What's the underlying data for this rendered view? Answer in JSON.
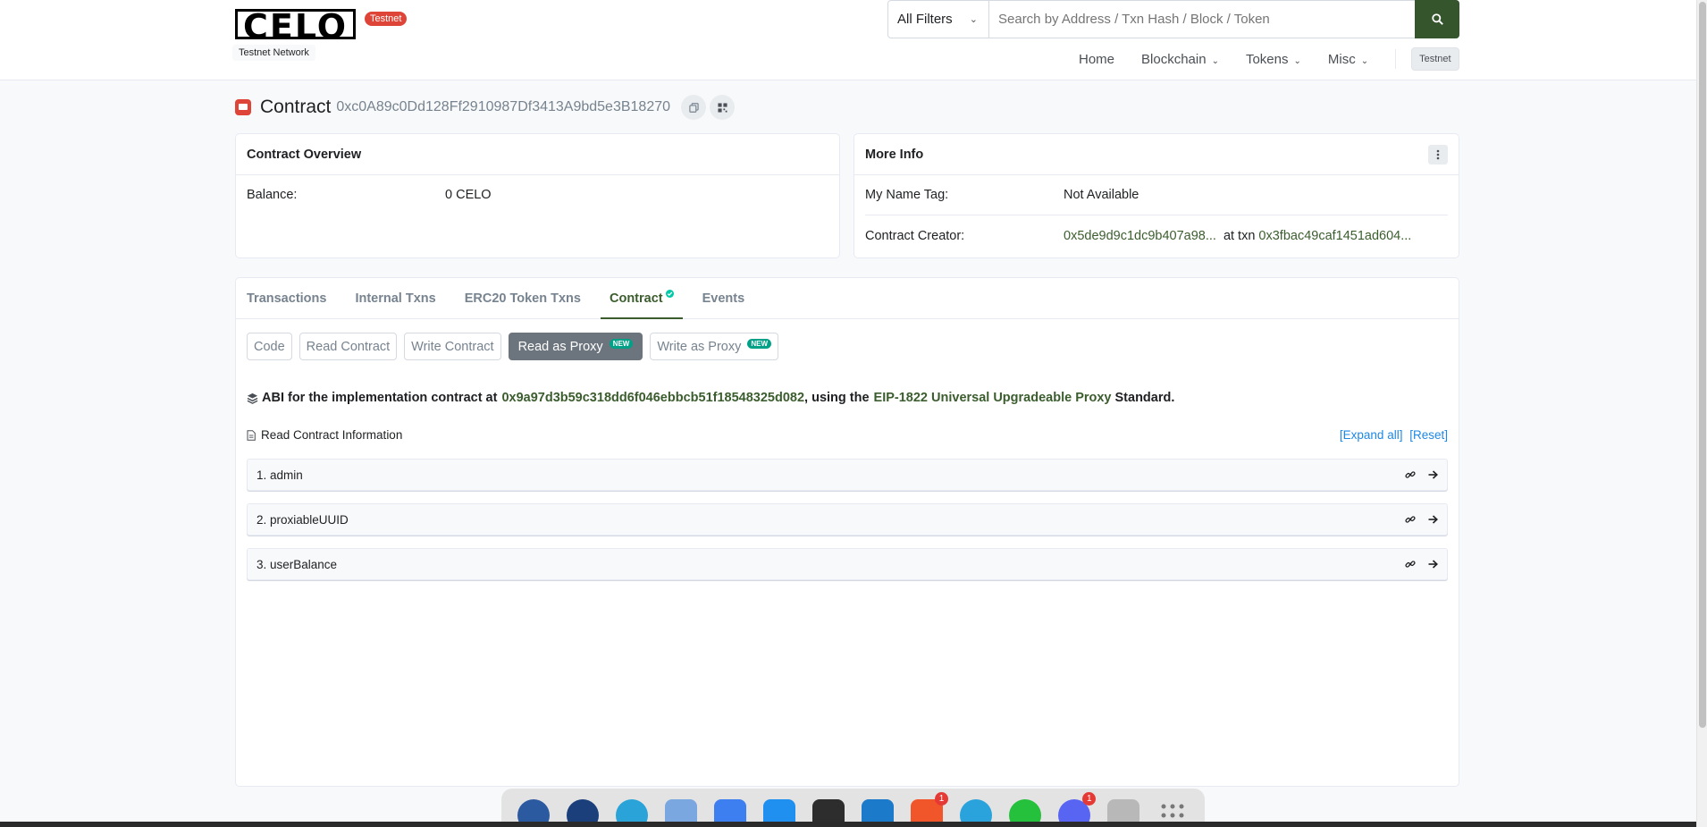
{
  "header": {
    "logo_text": "CELO",
    "testnet_badge": "Testnet",
    "network_label": "Testnet Network",
    "filter_selected": "All Filters",
    "search_placeholder": "Search by Address / Txn Hash / Block / Token",
    "nav": {
      "home": "Home",
      "blockchain": "Blockchain",
      "tokens": "Tokens",
      "misc": "Misc",
      "network_badge": "Testnet"
    }
  },
  "page": {
    "title_label": "Contract",
    "address": "0xc0A89c0Dd128Ff2910987Df3413A9bd5e3B18270"
  },
  "overview": {
    "title": "Contract Overview",
    "balance_label": "Balance:",
    "balance_value": "0 CELO"
  },
  "more_info": {
    "title": "More Info",
    "name_tag_label": "My Name Tag:",
    "name_tag_value": "Not Available",
    "creator_label": "Contract Creator:",
    "creator_address": "0x5de9d9c1dc9b407a98...",
    "at_txn_text": "at txn",
    "creator_txn": "0x3fbac49caf1451ad604..."
  },
  "tabs": {
    "transactions": "Transactions",
    "internal_txns": "Internal Txns",
    "erc20_txns": "ERC20 Token Txns",
    "contract": "Contract",
    "events": "Events"
  },
  "sub_buttons": {
    "code": "Code",
    "read_contract": "Read Contract",
    "write_contract": "Write Contract",
    "read_as_proxy": "Read as Proxy",
    "write_as_proxy": "Write as Proxy",
    "new_badge": "NEW"
  },
  "abi": {
    "prefix": "ABI for the implementation contract at",
    "impl_address": "0x9a97d3b59c318dd6f046ebbcb51f18548325d082",
    "middle": ", using the",
    "standard_link": "EIP-1822 Universal Upgradeable Proxy",
    "suffix": "Standard."
  },
  "read_info": {
    "label": "Read Contract Information",
    "expand_all": "[Expand all]",
    "reset": "[Reset]"
  },
  "functions": [
    {
      "label": "1. admin"
    },
    {
      "label": "2. proxiableUUID"
    },
    {
      "label": "3. userBalance"
    }
  ],
  "dock": {
    "brave_badge": "1",
    "discord_badge": "1"
  },
  "colors": {
    "brand_green": "#35552d",
    "link_green": "#3b5d2e",
    "accent_red": "#de4437",
    "link_blue": "#1e88e5"
  }
}
